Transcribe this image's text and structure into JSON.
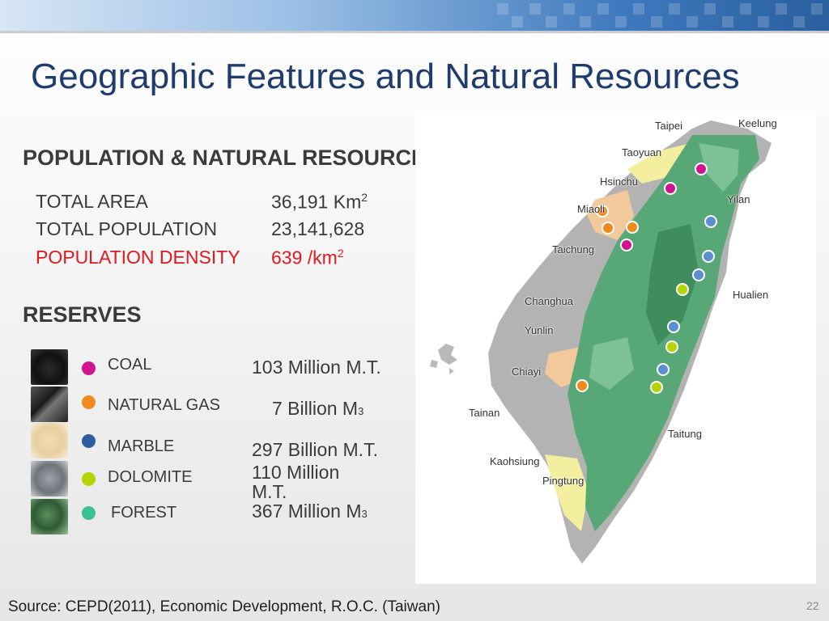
{
  "title": "Geographic Features and Natural Resources",
  "population": {
    "heading": "POPULATION & NATURAL RESOURCES",
    "rows": [
      {
        "label": "TOTAL AREA",
        "value": "36,191  Km",
        "sup": "2"
      },
      {
        "label": "TOTAL POPULATION",
        "value": "23,141,628",
        "sup": ""
      },
      {
        "label": "POPULATION DENSITY",
        "value": "639 /km",
        "sup": "2"
      }
    ],
    "highlight_color": "#e0191e"
  },
  "reserves": {
    "heading": "RESERVES",
    "items": [
      {
        "label": "COAL",
        "value": "103  Million M.T.",
        "unit_sub": "",
        "color": "#d1138f"
      },
      {
        "label": "NATURAL GAS",
        "value": "7  Billion M",
        "unit_sub": "3",
        "color": "#f08a1e"
      },
      {
        "label": "MARBLE",
        "value": "297  Billion M.T.",
        "unit_sub": "",
        "color": "#2e5d9e"
      },
      {
        "label": "DOLOMITE",
        "value": "110  Million M.T.",
        "unit_sub": "",
        "color": "#b5d400"
      },
      {
        "label": "FOREST",
        "value": "367  Million M",
        "unit_sub": "3",
        "color": "#3bbf94"
      }
    ]
  },
  "map": {
    "cities": [
      "Taipei",
      "Keelung",
      "Taoyuan",
      "Hsinchu",
      "Yilan",
      "Miaoli",
      "Taichung",
      "Changhua",
      "Hualien",
      "Yunlin",
      "Chiayi",
      "Tainan",
      "Taitung",
      "Kaohsiung",
      "Pingtung"
    ]
  },
  "source": "Source: CEPD(2011), Economic Development, R.O.C. (Taiwan)",
  "page_number": "22"
}
